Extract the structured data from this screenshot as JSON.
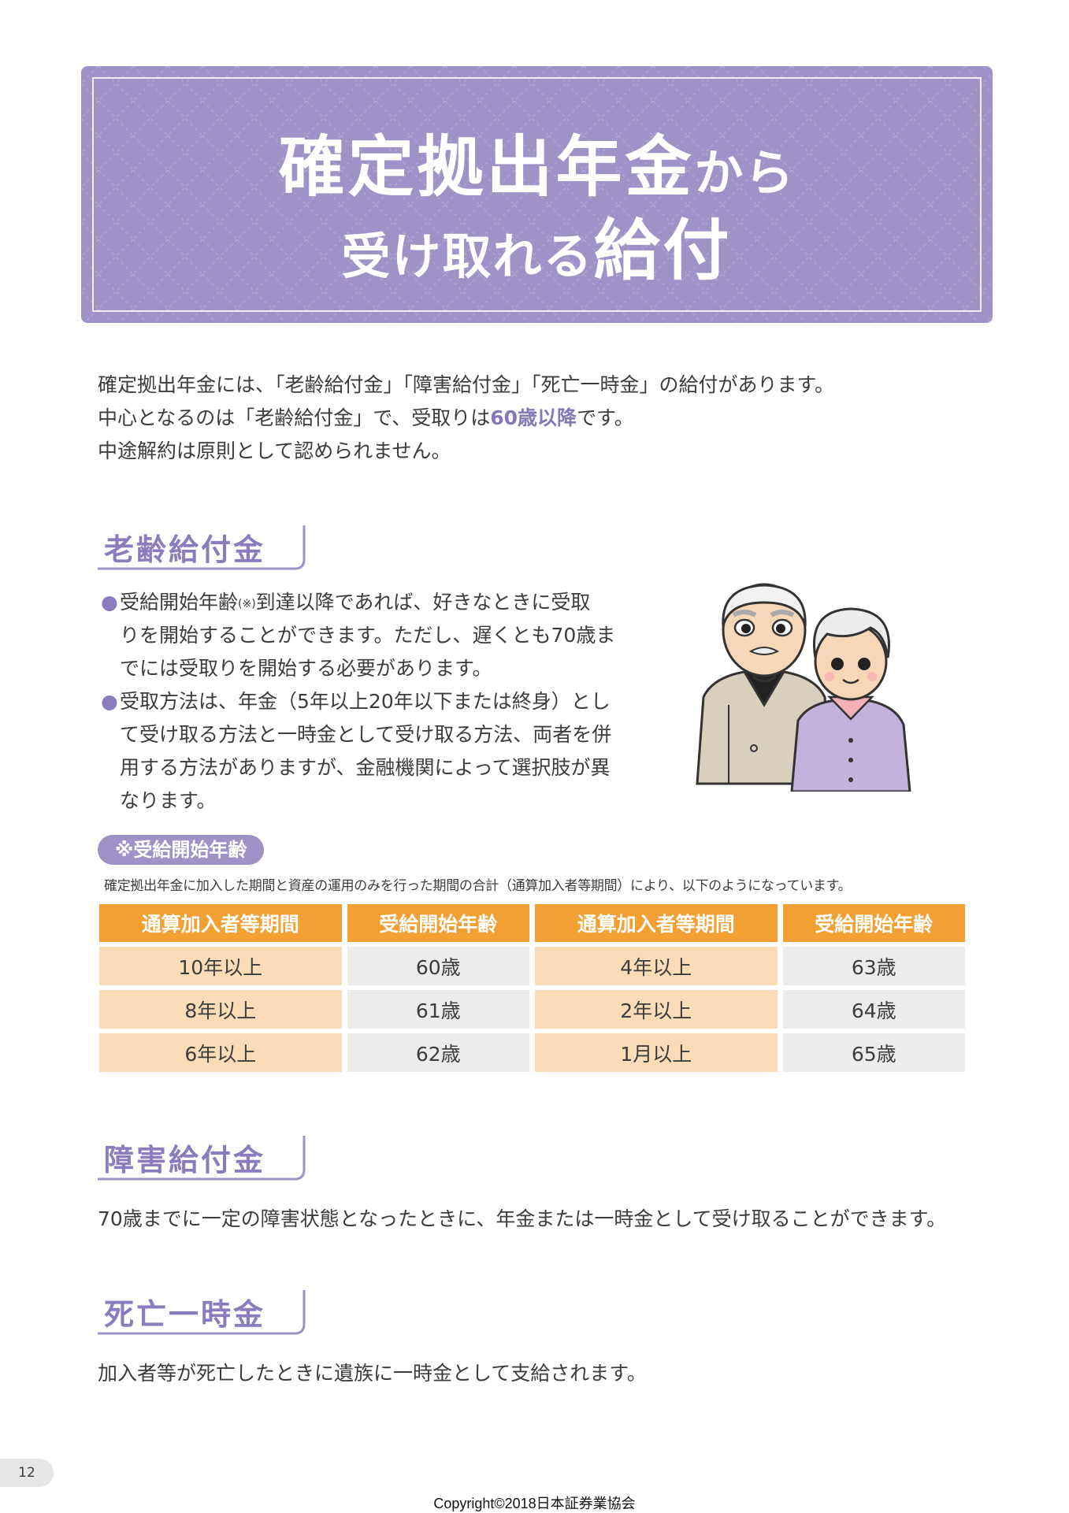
{
  "banner": {
    "title_line1_big": "確定拠出年金",
    "title_line1_small": "から",
    "title_line2_small": "受け取れる",
    "title_line2_big": "給付"
  },
  "intro": {
    "line1": "確定拠出年金には、「老齢給付金」「障害給付金」「死亡一時金」の給付があります。",
    "line2_before": "中心となるのは「老齢給付金」で、受取りは",
    "line2_highlight": "60歳以降",
    "line2_after": "です。",
    "line3": "中途解約は原則として認められません。"
  },
  "section_old_age": {
    "heading": "老齢給付金",
    "bullet1_part1": "受給開始年齢",
    "bullet1_sup": "(※)",
    "bullet1_line1_rest": "到達以降であれば、好きなときに受取",
    "bullet1_line2": "りを開始することができます。ただし、遅くとも70歳ま",
    "bullet1_line3": "でには受取りを開始する必要があります。",
    "bullet2_line1": "受取方法は、年金（5年以上20年以下または終身）とし",
    "bullet2_line2": "て受け取る方法と一時金として受け取る方法、両者を併",
    "bullet2_line3": "用する方法がありますが、金融機関によって選択肢が異",
    "bullet2_line4": "なります。"
  },
  "start_age": {
    "pill": "※受給開始年齢",
    "note": "確定拠出年金に加入した期間と資産の運用のみを行った期間の合計（通算加入者等期間）により、以下のようになっています。",
    "headers": [
      "通算加入者等期間",
      "受給開始年齢",
      "通算加入者等期間",
      "受給開始年齢"
    ],
    "rows": [
      [
        "10年以上",
        "60歳",
        "4年以上",
        "63歳"
      ],
      [
        "8年以上",
        "61歳",
        "2年以上",
        "64歳"
      ],
      [
        "6年以上",
        "62歳",
        "1月以上",
        "65歳"
      ]
    ]
  },
  "section_disability": {
    "heading": "障害給付金",
    "text": "70歳までに一定の障害状態となったときに、年金または一時金として受け取ることができます。"
  },
  "section_death": {
    "heading": "死亡一時金",
    "text": "加入者等が死亡したときに遺族に一時金として支給されます。"
  },
  "page_number": "12",
  "copyright": "Copyright©2018日本証券業協会",
  "colors": {
    "purple": "#9f92c6",
    "purple_text": "#8b7dbd",
    "orange_header": "#f2a034",
    "peach_cell": "#fbdcb8",
    "gray_cell": "#ececeb"
  }
}
